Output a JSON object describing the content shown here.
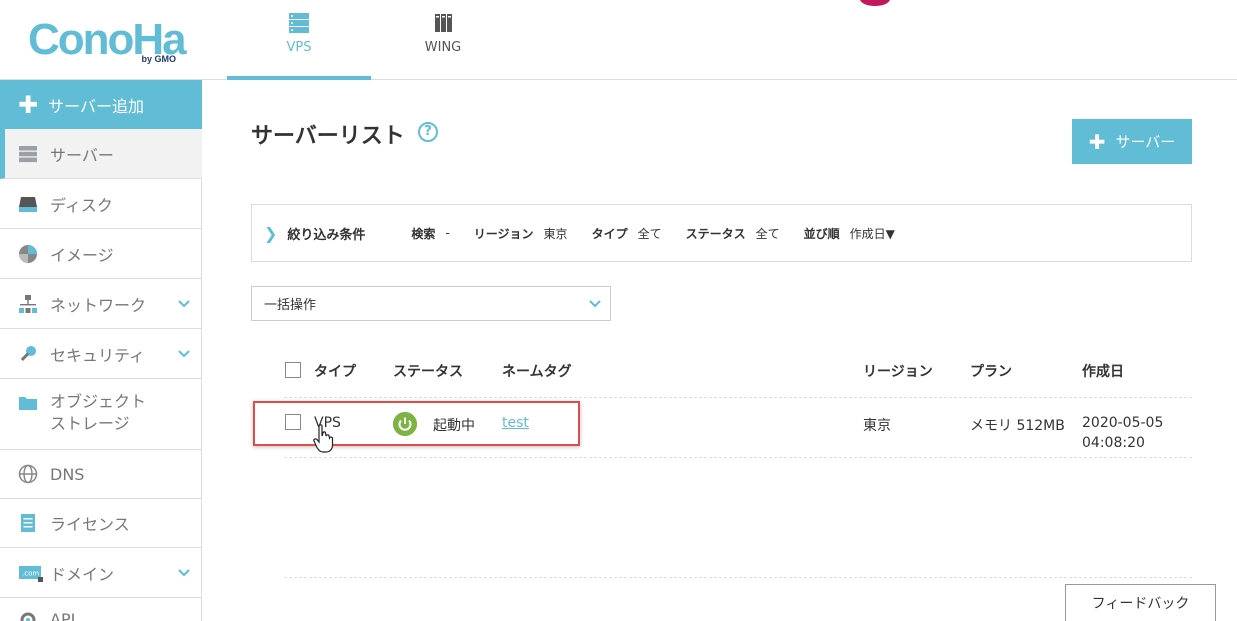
{
  "header": {
    "logo_text": "ConoHa",
    "logo_sub": "by GMO",
    "tabs": [
      {
        "label": "VPS",
        "active": true
      },
      {
        "label": "WING",
        "active": false
      }
    ]
  },
  "sidebar": {
    "add_label": "サーバー追加",
    "items": [
      {
        "label": "サーバー",
        "icon": "server-icon",
        "active": true
      },
      {
        "label": "ディスク",
        "icon": "disk-icon"
      },
      {
        "label": "イメージ",
        "icon": "image-icon"
      },
      {
        "label": "ネットワーク",
        "icon": "network-icon",
        "expandable": true
      },
      {
        "label": "セキュリティ",
        "icon": "key-icon",
        "expandable": true
      },
      {
        "label_line1": "オブジェクト",
        "label_line2": "ストレージ",
        "icon": "folder-icon"
      },
      {
        "label": "DNS",
        "icon": "globe-icon"
      },
      {
        "label": "ライセンス",
        "icon": "license-icon"
      },
      {
        "label": "ドメイン",
        "icon": "domain-icon",
        "icon_text": ".com",
        "expandable": true
      },
      {
        "label": "API",
        "icon": "api-icon"
      }
    ]
  },
  "main": {
    "title": "サーバーリスト",
    "help_glyph": "?",
    "add_button_label": "サーバー",
    "filter": {
      "toggle_label": "絞り込み条件",
      "search_label": "検索",
      "search_value": "-",
      "region_label": "リージョン",
      "region_value": "東京",
      "type_label": "タイプ",
      "type_value": "全て",
      "status_label": "ステータス",
      "status_value": "全て",
      "sort_label": "並び順",
      "sort_value": "作成日▼"
    },
    "bulk_action": {
      "selected": "一括操作"
    },
    "table": {
      "headers": {
        "type": "タイプ",
        "status": "ステータス",
        "nametag": "ネームタグ",
        "region": "リージョン",
        "plan": "プラン",
        "created": "作成日"
      },
      "rows": [
        {
          "type": "VPS",
          "status": "起動中",
          "nametag": "test",
          "region": "東京",
          "plan": "メモリ 512MB",
          "created_date": "2020-05-05",
          "created_time": "04:08:20"
        }
      ]
    },
    "feedback_label": "フィードバック"
  },
  "colors": {
    "accent": "#61bcd6",
    "status_running": "#7cb342",
    "highlight": "#e04c4c"
  }
}
